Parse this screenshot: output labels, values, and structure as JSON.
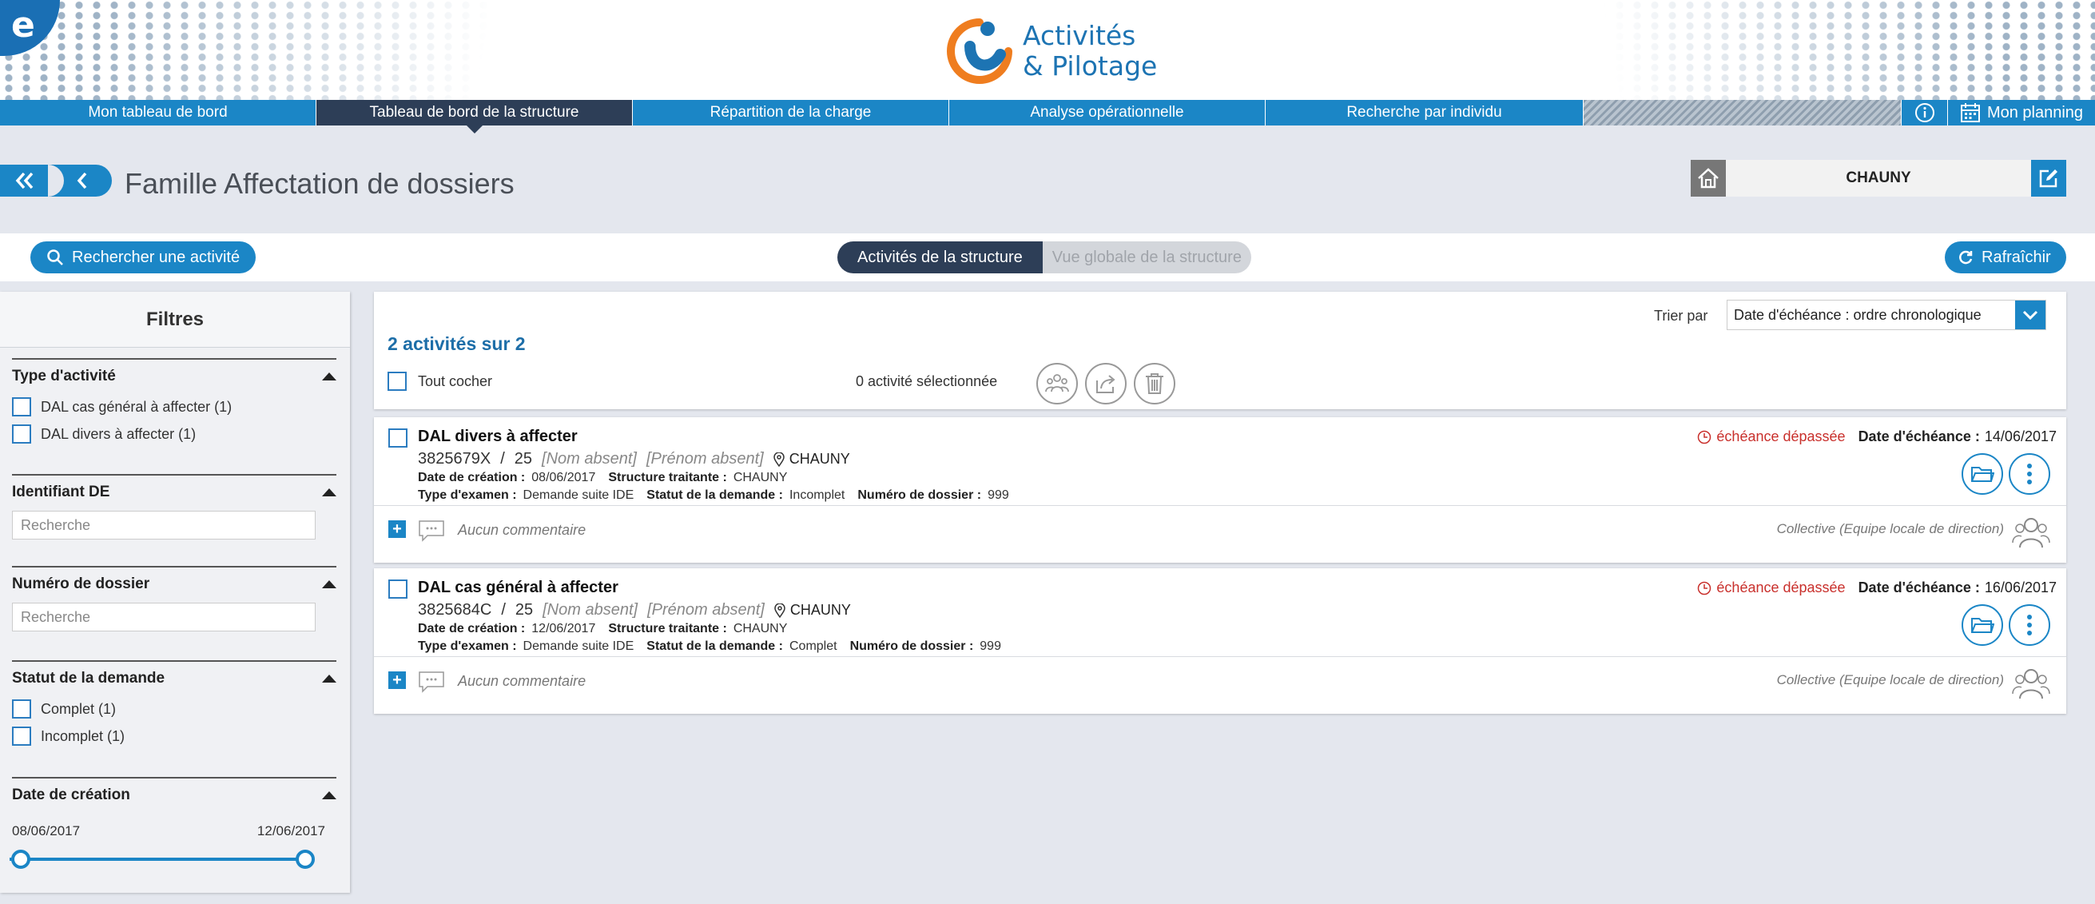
{
  "header": {
    "app_title_line1": "Activités",
    "app_title_line2": "& Pilotage",
    "logo_letter": "e"
  },
  "nav": {
    "items": [
      "Mon tableau de bord",
      "Tableau de bord de la structure",
      "Répartition de la charge",
      "Analyse opérationnelle",
      "Recherche par individu"
    ],
    "active_index": 1,
    "planning_label": "Mon planning"
  },
  "page": {
    "title": "Famille Affectation de dossiers",
    "structure_name": "CHAUNY"
  },
  "toolbar": {
    "search_label": "Rechercher une activité",
    "tab_structure": "Activités de la structure",
    "tab_global": "Vue globale de la structure",
    "refresh_label": "Rafraîchir"
  },
  "filters": {
    "title": "Filtres",
    "type_activite": {
      "title": "Type d'activité",
      "options": [
        "DAL cas général à affecter (1)",
        "DAL divers à affecter (1)"
      ]
    },
    "identifiant": {
      "title": "Identifiant DE",
      "placeholder": "Recherche"
    },
    "numero": {
      "title": "Numéro de dossier",
      "placeholder": "Recherche"
    },
    "statut": {
      "title": "Statut de la demande",
      "options": [
        "Complet (1)",
        "Incomplet (1)"
      ]
    },
    "date_creation": {
      "title": "Date de création",
      "start": "08/06/2017",
      "end": "12/06/2017"
    }
  },
  "list": {
    "count_label": "2 activités sur 2",
    "sort_label": "Trier par",
    "sort_value": "Date d'échéance : ordre chronologique",
    "check_all": "Tout cocher",
    "selected_label": "0 activité sélectionnée"
  },
  "labels": {
    "date_creation": "Date de création :",
    "structure": "Structure traitante :",
    "type_examen": "Type d'examen :",
    "statut": "Statut de la demande :",
    "numero": "Numéro de dossier :",
    "date_echeance": "Date d'échéance :",
    "echeance_depassee": "échéance dépassée",
    "no_comment": "Aucun commentaire",
    "assignee": "Collective (Equipe locale de direction)",
    "separator": "/",
    "plus": "+"
  },
  "activities": [
    {
      "title": "DAL divers à affecter",
      "id": "3825679X",
      "suffix": "25",
      "nom": "[Nom absent]",
      "prenom": "[Prénom absent]",
      "lieu": "CHAUNY",
      "date_creation": "08/06/2017",
      "structure": "CHAUNY",
      "type_examen": "Demande suite IDE",
      "statut": "Incomplet",
      "numero": "999",
      "date_echeance": "14/06/2017"
    },
    {
      "title": "DAL cas général à affecter",
      "id": "3825684C",
      "suffix": "25",
      "nom": "[Nom absent]",
      "prenom": "[Prénom absent]",
      "lieu": "CHAUNY",
      "date_creation": "12/06/2017",
      "structure": "CHAUNY",
      "type_examen": "Demande suite IDE",
      "statut": "Complet",
      "numero": "999",
      "date_echeance": "16/06/2017"
    }
  ],
  "colors": {
    "primary": "#1b86c6",
    "dark": "#2d3e57",
    "overdue": "#c9302c"
  }
}
